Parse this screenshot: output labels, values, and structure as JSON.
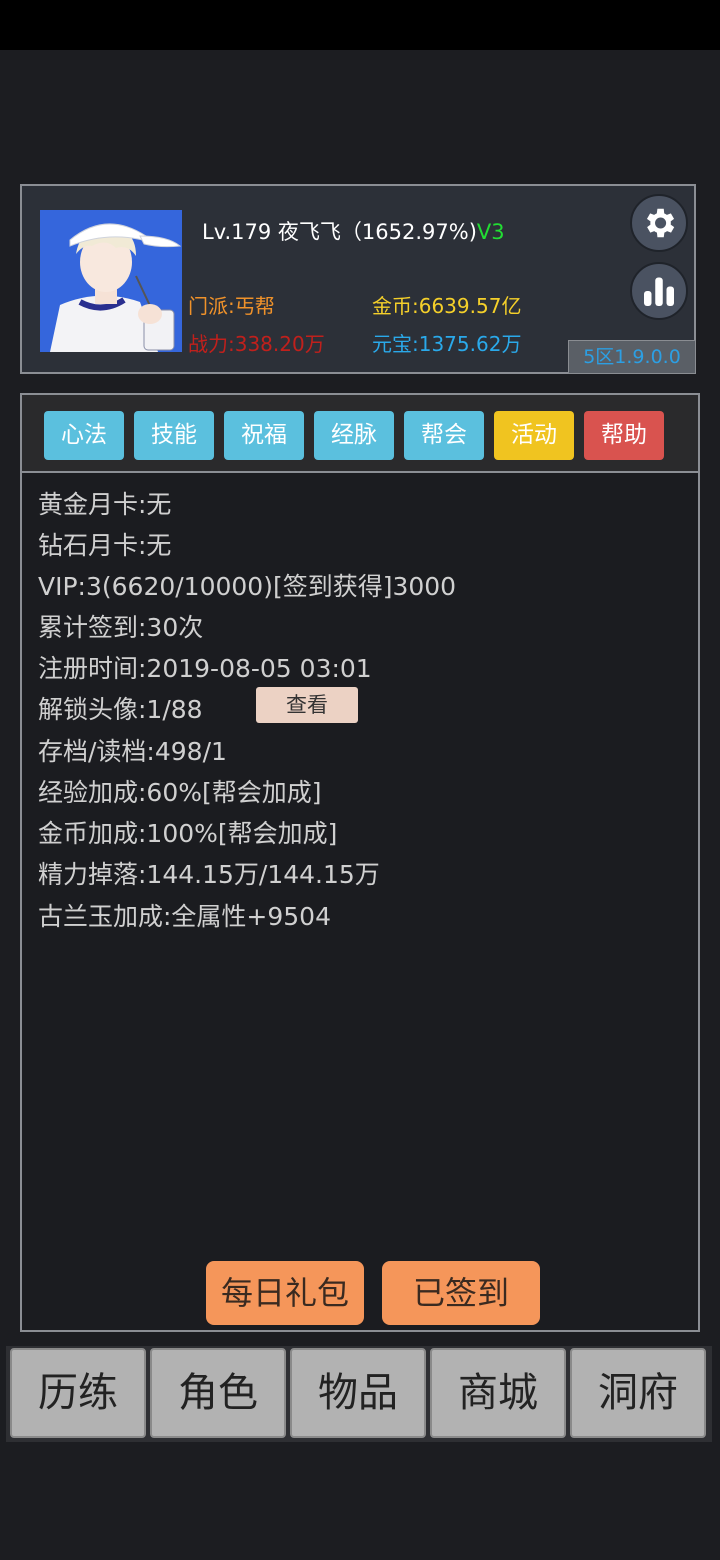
{
  "profile": {
    "level_name": "Lv.179 夜飞飞（1652.97%)",
    "vip": "V3",
    "faction": "门派:丐帮",
    "power": "战力:338.20万",
    "gold": "金币:6639.57亿",
    "yuanbao": "元宝:1375.62万",
    "version": "5区1.9.0.0"
  },
  "tabs": [
    {
      "label": "心法",
      "color": "#5bc0de"
    },
    {
      "label": "技能",
      "color": "#5bc0de"
    },
    {
      "label": "祝福",
      "color": "#5bc0de"
    },
    {
      "label": "经脉",
      "color": "#5bc0de"
    },
    {
      "label": "帮会",
      "color": "#5bc0de"
    },
    {
      "label": "活动",
      "color": "#f0c420"
    },
    {
      "label": "帮助",
      "color": "#d9534f"
    }
  ],
  "info": [
    "黄金月卡:无",
    "钻石月卡:无",
    "VIP:3(6620/10000)[签到获得]3000",
    "累计签到:30次",
    "注册时间:2019-08-05 03:01",
    "解锁头像:1/88",
    "存档/读档:498/1",
    "经验加成:60%[帮会加成]",
    "金币加成:100%[帮会加成]",
    "精力掉落:144.15万/144.15万",
    "古兰玉加成:全属性+9504"
  ],
  "view_button": "查看",
  "daily_gift_button": "每日礼包",
  "signed_button": "已签到",
  "nav": [
    "历练",
    "角色",
    "物品",
    "商城",
    "洞府"
  ]
}
